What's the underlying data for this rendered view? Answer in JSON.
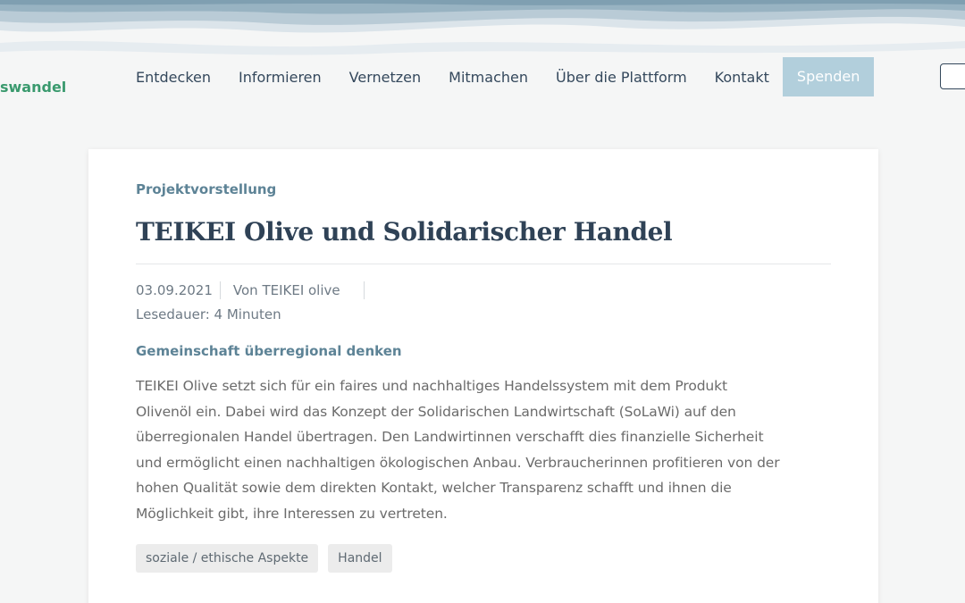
{
  "site": {
    "logo_text": "swandel"
  },
  "nav": {
    "items": [
      "Entdecken",
      "Informieren",
      "Vernetzen",
      "Mitmachen",
      "Über die Plattform",
      "Kontakt"
    ],
    "donate_label": "Spenden"
  },
  "article": {
    "category": "Projektvorstellung",
    "title": "TEIKEI Olive und Solidarischer Handel",
    "date": "03.09.2021",
    "author": "Von TEIKEI olive",
    "reading_time": "Lesedauer: 4 Minuten",
    "subheading": "Gemeinschaft überregional denken",
    "body_lines": [
      "TEIKEI Olive setzt sich für ein faires und nachhaltiges Handelssystem mit dem Produkt",
      "Olivenöl ein. Dabei wird das Konzept der Solidarischen Landwirtschaft (SoLaWi) auf den",
      "überregionalen Handel übertragen. Den Landwirtinnen verschafft dies finanzielle Sicherheit",
      "und ermöglicht einen nachhaltigen ökologischen Anbau. Verbraucherinnen profitieren von der",
      "hohen Qualität sowie dem direkten Kontakt, welcher Transparenz schafft und ihnen die",
      "Möglichkeit gibt, ihre Interessen zu vertreten."
    ],
    "tags": [
      "soziale / ethische Aspekte",
      "Handel"
    ]
  },
  "colors": {
    "logo_green": "#3a9a6e",
    "nav_text": "#34485c",
    "donate_bg": "#b2cfdc",
    "accent_blue": "#5d8396",
    "title": "#2f4256"
  }
}
